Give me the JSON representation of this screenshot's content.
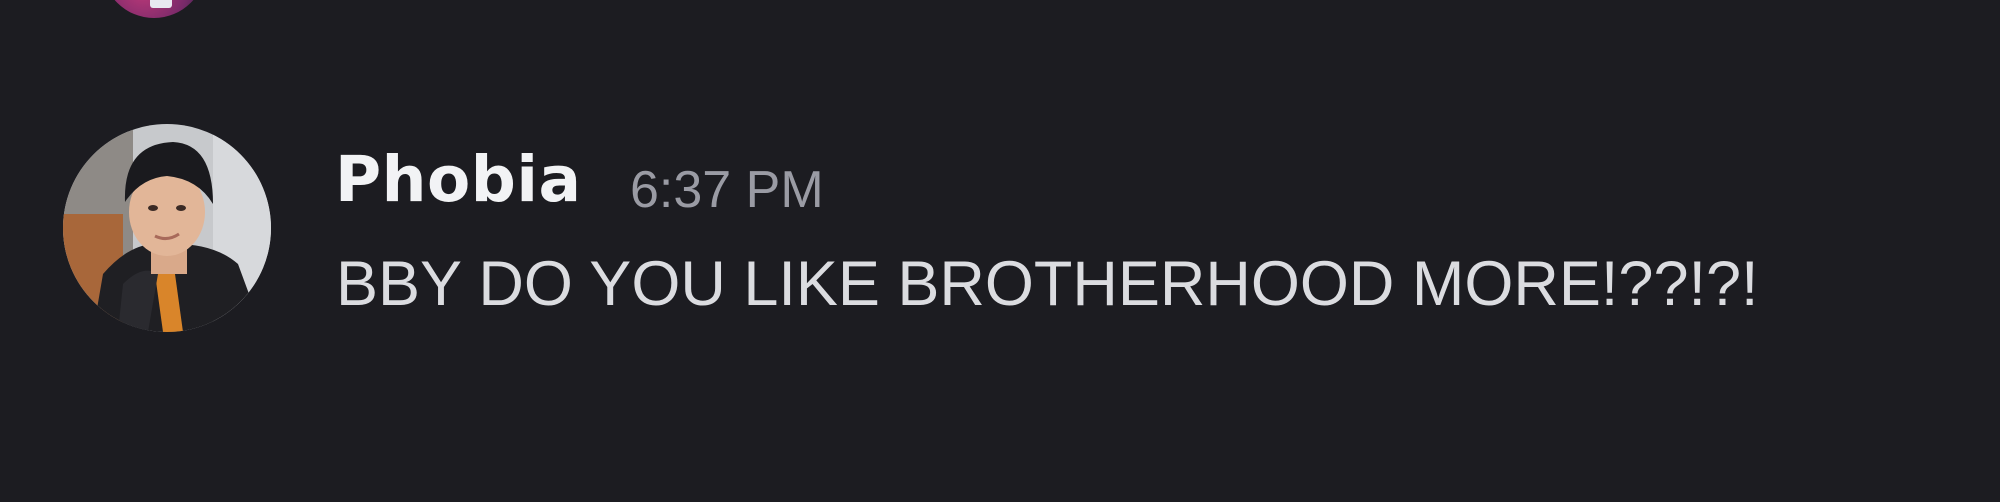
{
  "message": {
    "author": "Phobia",
    "timestamp": "6:37 PM",
    "content": "BBY DO YOU LIKE BROTHERHOOD MORE!??!?!"
  },
  "avatar": {
    "icon": "user-avatar-photo"
  },
  "colors": {
    "background": "#1c1c21",
    "author": "#f2f3f5",
    "timestamp": "#9a9ba4",
    "content": "#dbdce0"
  }
}
